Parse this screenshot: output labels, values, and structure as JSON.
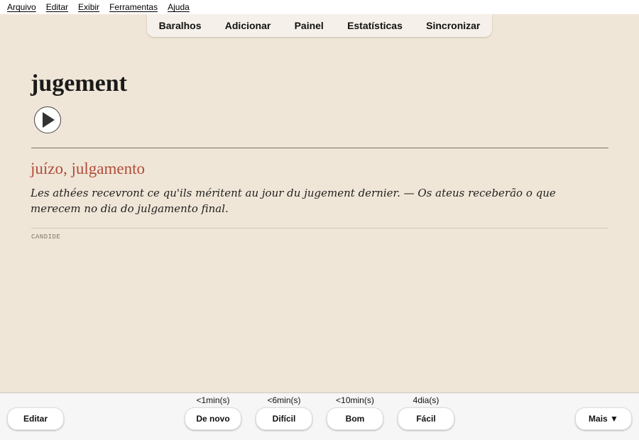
{
  "menu": {
    "items": [
      "Arquivo",
      "Editar",
      "Exibir",
      "Ferramentas",
      "Ajuda"
    ]
  },
  "toolbar": {
    "links": [
      "Baralhos",
      "Adicionar",
      "Painel",
      "Estatísticas",
      "Sincronizar"
    ]
  },
  "card": {
    "word": "jugement",
    "play_icon": "play-icon",
    "translation": "juízo, julgamento",
    "example": "Les athées recevront ce qu'ils méritent au jour du jugement dernier. — Os ateus receberão o que merecem no dia do julgamento final.",
    "source": "CANDIDE"
  },
  "bottom": {
    "edit_label": "Editar",
    "more_label": "Mais ▼",
    "answers": [
      {
        "interval": "<1min(s)",
        "label": "De novo"
      },
      {
        "interval": "<6min(s)",
        "label": "Difícil"
      },
      {
        "interval": "<10min(s)",
        "label": "Bom"
      },
      {
        "interval": "4dia(s)",
        "label": "Fácil"
      }
    ]
  },
  "colors": {
    "background": "#f0e6d7",
    "translation": "#b14c39",
    "bottom_bar": "#f6f6f6"
  }
}
